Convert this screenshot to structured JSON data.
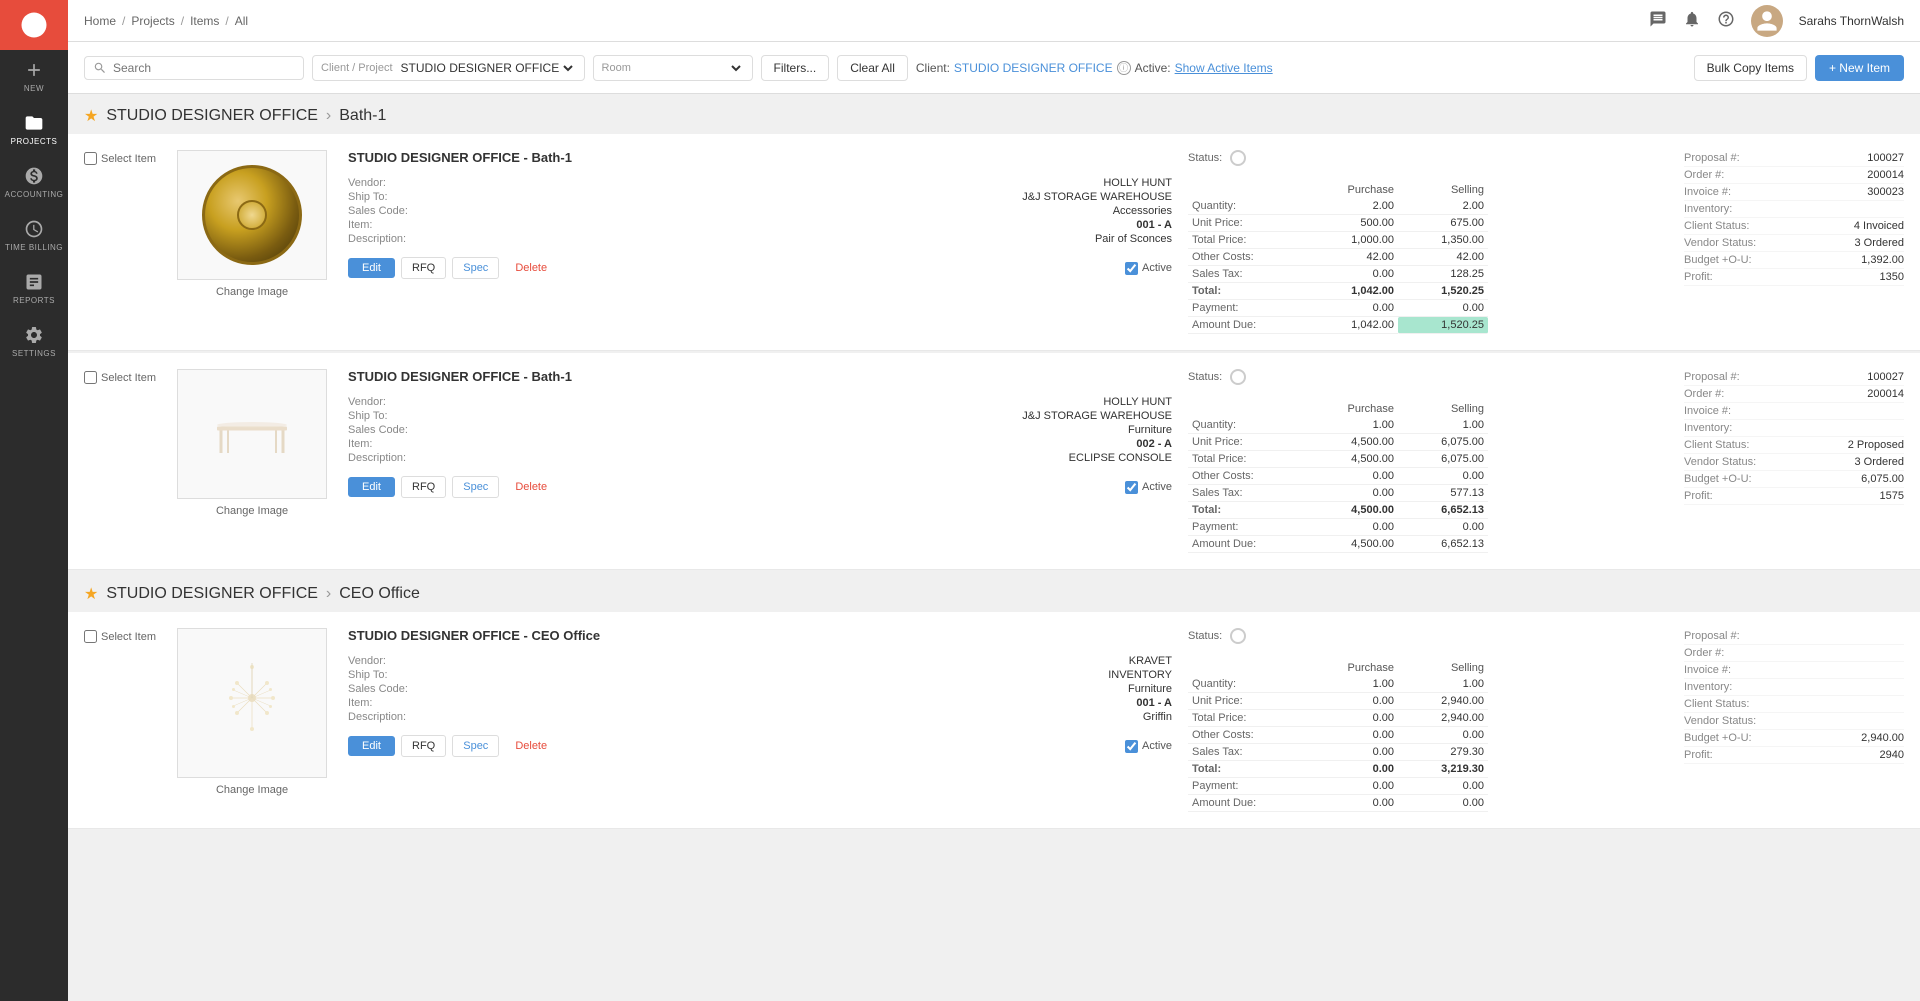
{
  "app": {
    "logo_color": "#e74c3c"
  },
  "nav": {
    "breadcrumb": [
      "Home",
      "Projects",
      "Items",
      "All"
    ]
  },
  "sidebar": {
    "items": [
      {
        "id": "new",
        "label": "NEW",
        "icon": "plus"
      },
      {
        "id": "projects",
        "label": "PROJECTS",
        "icon": "folder",
        "active": true
      },
      {
        "id": "accounting",
        "label": "ACCOUNTING",
        "icon": "dollar"
      },
      {
        "id": "time-billing",
        "label": "TIME BILLING",
        "icon": "clock"
      },
      {
        "id": "reports",
        "label": "REPORTS",
        "icon": "bar-chart"
      },
      {
        "id": "settings",
        "label": "SETTINGS",
        "icon": "gear"
      }
    ]
  },
  "toolbar": {
    "search_placeholder": "Search",
    "client_project_label": "Client / Project",
    "client_project_value": "STUDIO DESIGNER OFFICE",
    "room_label": "Room",
    "room_value": "",
    "filters_button": "Filters...",
    "clear_button": "Clear All",
    "client_label": "Client:",
    "client_value": "STUDIO DESIGNER OFFICE",
    "active_label": "Active:",
    "show_active": "Show Active Items",
    "bulk_copy": "Bulk Copy Items",
    "new_item": "+ New Item"
  },
  "sections": [
    {
      "id": "bath1",
      "client": "STUDIO DESIGNER OFFICE",
      "arrow": "›",
      "room": "Bath-1",
      "items": [
        {
          "id": "item1",
          "title": "STUDIO DESIGNER OFFICE - Bath-1",
          "vendor": "HOLLY HUNT",
          "ship_to": "J&J STORAGE WAREHOUSE",
          "sales_code": "Accessories",
          "item_num": "001 - A",
          "description": "Pair of Sconces",
          "status_circle": true,
          "purchase_qty": "2.00",
          "selling_qty": "2.00",
          "purchase_unit": "500.00",
          "selling_unit": "675.00",
          "purchase_total": "1,000.00",
          "selling_total": "1,350.00",
          "purchase_other": "42.00",
          "selling_other": "42.00",
          "purchase_tax": "0.00",
          "selling_tax": "128.25",
          "purchase_grand": "1,042.00",
          "selling_grand": "1,520.25",
          "purchase_payment": "0.00",
          "selling_payment": "0.00",
          "purchase_due": "1,042.00",
          "selling_due": "1,520.25",
          "selling_due_highlight": true,
          "proposal_num": "100027",
          "order_num": "200014",
          "invoice_num": "300023",
          "inventory": "",
          "client_status": "4 Invoiced",
          "vendor_status": "3 Ordered",
          "budget_ou": "1,392.00",
          "profit": "1350",
          "active": true,
          "image_type": "plate"
        },
        {
          "id": "item2",
          "title": "STUDIO DESIGNER OFFICE - Bath-1",
          "vendor": "HOLLY HUNT",
          "ship_to": "J&J STORAGE WAREHOUSE",
          "sales_code": "Furniture",
          "item_num": "002 - A",
          "description": "ECLIPSE CONSOLE",
          "status_circle": true,
          "purchase_qty": "1.00",
          "selling_qty": "1.00",
          "purchase_unit": "4,500.00",
          "selling_unit": "6,075.00",
          "purchase_total": "4,500.00",
          "selling_total": "6,075.00",
          "purchase_other": "0.00",
          "selling_other": "0.00",
          "purchase_tax": "0.00",
          "selling_tax": "577.13",
          "purchase_grand": "4,500.00",
          "selling_grand": "6,652.13",
          "purchase_payment": "0.00",
          "selling_payment": "0.00",
          "purchase_due": "4,500.00",
          "selling_due": "6,652.13",
          "selling_due_highlight": false,
          "proposal_num": "100027",
          "order_num": "200014",
          "invoice_num": "",
          "inventory": "",
          "client_status": "2 Proposed",
          "vendor_status": "3 Ordered",
          "budget_ou": "6,075.00",
          "profit": "1575",
          "active": true,
          "image_type": "table"
        }
      ]
    },
    {
      "id": "ceo-office",
      "client": "STUDIO DESIGNER OFFICE",
      "arrow": "›",
      "room": "CEO Office",
      "items": [
        {
          "id": "item3",
          "title": "STUDIO DESIGNER OFFICE - CEO Office",
          "vendor": "KRAVET",
          "ship_to": "INVENTORY",
          "sales_code": "Furniture",
          "item_num": "001 - A",
          "description": "Griffin",
          "status_circle": true,
          "purchase_qty": "1.00",
          "selling_qty": "1.00",
          "purchase_unit": "0.00",
          "selling_unit": "2,940.00",
          "purchase_total": "0.00",
          "selling_total": "2,940.00",
          "purchase_other": "0.00",
          "selling_other": "0.00",
          "purchase_tax": "0.00",
          "selling_tax": "279.30",
          "purchase_grand": "0.00",
          "selling_grand": "3,219.30",
          "purchase_payment": "0.00",
          "selling_payment": "0.00",
          "purchase_due": "0.00",
          "selling_due": "0.00",
          "selling_due_highlight": false,
          "proposal_num": "",
          "order_num": "",
          "invoice_num": "",
          "inventory": "",
          "client_status": "",
          "vendor_status": "",
          "budget_ou": "2,940.00",
          "profit": "2940",
          "active": true,
          "image_type": "chandelier"
        }
      ]
    }
  ],
  "labels": {
    "select_item": "Select Item",
    "change_image": "Change Image",
    "vendor": "Vendor:",
    "ship_to": "Ship To:",
    "sales_code": "Sales Code:",
    "item": "Item:",
    "description": "Description:",
    "status": "Status:",
    "purchase": "Purchase",
    "selling": "Selling",
    "quantity": "Quantity:",
    "unit_price": "Unit Price:",
    "total_price": "Total Price:",
    "other_costs": "Other Costs:",
    "sales_tax": "Sales Tax:",
    "total": "Total:",
    "payment": "Payment:",
    "amount_due": "Amount Due:",
    "proposal": "Proposal #:",
    "order": "Order #:",
    "invoice": "Invoice #:",
    "inventory": "Inventory:",
    "client_status": "Client Status:",
    "vendor_status": "Vendor Status:",
    "budget_ou": "Budget +O-U:",
    "profit": "Profit:",
    "edit": "Edit",
    "rfq": "RFQ",
    "spec": "Spec",
    "delete": "Delete",
    "active": "Active"
  },
  "user": {
    "name": "Sarahs ThornWalsh",
    "avatar_color": "#c8a882"
  }
}
